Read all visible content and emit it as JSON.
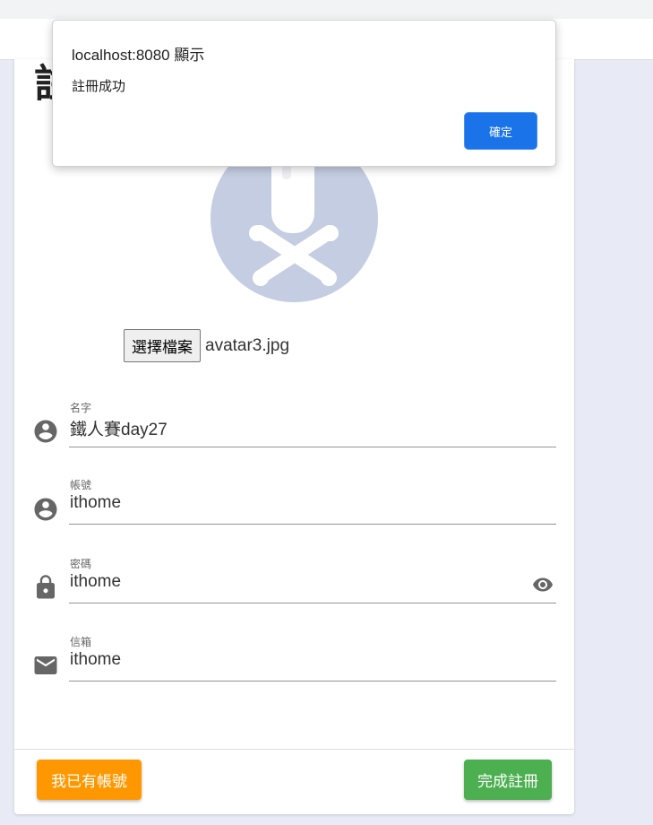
{
  "page": {
    "title_glyph": "註"
  },
  "dialog": {
    "origin": "localhost:8080 顯示",
    "message": "註冊成功",
    "ok_label": "確定"
  },
  "avatar": {
    "icon": "skull-crossbones-placeholder"
  },
  "file_input": {
    "button_label": "選擇檔案",
    "file_name": "avatar3.jpg"
  },
  "fields": [
    {
      "label": "名字",
      "value": "鐵人賽day27",
      "icon": "account-circle-icon"
    },
    {
      "label": "帳號",
      "value": "ithome",
      "icon": "account-circle-icon"
    },
    {
      "label": "密碼",
      "value": "ithome",
      "icon": "lock-icon",
      "trailing_icon": "eye-icon"
    },
    {
      "label": "信箱",
      "value": "ithome",
      "icon": "email-icon"
    }
  ],
  "actions": {
    "login_label": "我已有帳號",
    "register_label": "完成註冊"
  },
  "colors": {
    "page_bg": "#e8eaf6",
    "login_button": "#ff9800",
    "register_button": "#4caf50",
    "dialog_ok": "#1a73e8",
    "avatar_bg": "#c5cde2",
    "icon": "#666666"
  }
}
